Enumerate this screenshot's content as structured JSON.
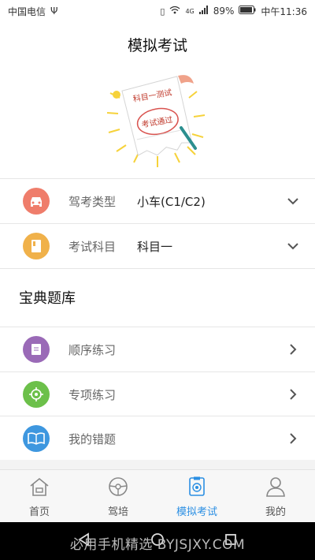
{
  "status_bar": {
    "carrier": "中国电信",
    "network": "4G",
    "battery": "89%",
    "time": "中午11:36"
  },
  "header": {
    "title": "模拟考试"
  },
  "hero": {
    "ribbon_text": "科目一测试",
    "stamp_text": "考试通过"
  },
  "settings": [
    {
      "label": "驾考类型",
      "value": "小车(C1/C2)",
      "icon": "car-icon",
      "color": "#ef7d6b"
    },
    {
      "label": "考试科目",
      "value": "科目一",
      "icon": "book-icon",
      "color": "#f0b14a"
    }
  ],
  "section": {
    "title": "宝典题库"
  },
  "practice_items": [
    {
      "label": "顺序练习",
      "icon": "document-icon",
      "color": "#9a6ab7"
    },
    {
      "label": "专项练习",
      "icon": "target-icon",
      "color": "#6cc04a"
    },
    {
      "label": "我的错题",
      "icon": "open-book-icon",
      "color": "#3e97df"
    }
  ],
  "tabs": [
    {
      "label": "首页",
      "icon": "home-icon",
      "active": false
    },
    {
      "label": "驾培",
      "icon": "steering-wheel-icon",
      "active": false
    },
    {
      "label": "模拟考试",
      "icon": "exam-icon",
      "active": true
    },
    {
      "label": "我的",
      "icon": "person-icon",
      "active": false
    }
  ],
  "watermark": "必用手机精选 BYJSJXY.COM",
  "colors": {
    "accent": "#2b8fe3",
    "nav_bg": "#000000"
  }
}
